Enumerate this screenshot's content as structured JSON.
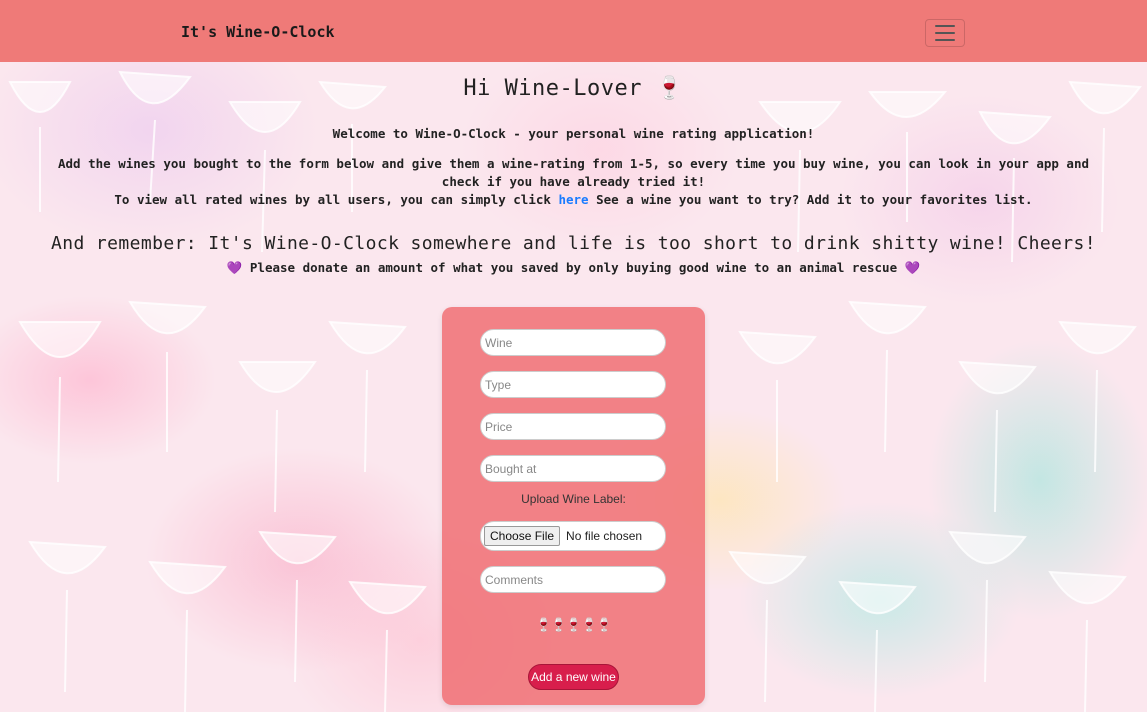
{
  "navbar": {
    "brand": "It's Wine-O-Clock",
    "toggle_icon": "hamburger-icon",
    "background": "#ef7a78"
  },
  "main": {
    "title": "Hi Wine-Lover 🍷",
    "welcome": "Welcome to Wine-O-Clock - your personal wine rating application!",
    "instructions": "Add the wines you bought to the form below and give them a wine-rating from 1-5, so every time you buy wine, you can look in your app and check if you have already tried it!",
    "view_prefix": "To view all rated wines by all users, you can simply click",
    "view_link": "here",
    "view_suffix": "See a wine you want to try? Add it to your favorites list.",
    "remember": "And remember: It's Wine-O-Clock somewhere and life is too short to drink shitty wine! Cheers!",
    "donate": "💜 Please donate an amount of what you saved by only buying good wine to an animal rescue 💜"
  },
  "form": {
    "wine_placeholder": "Wine",
    "type_placeholder": "Type",
    "price_placeholder": "Price",
    "bought_at_placeholder": "Bought at",
    "upload_label": "Upload Wine Label:",
    "file_button": "Choose File",
    "file_status": "No file chosen",
    "comments_placeholder": "Comments",
    "rating_glyphs": "🍷🍷🍷🍷🍷",
    "rating_max": 5,
    "submit_label": "Add a new wine",
    "card_color": "#ef6e73",
    "submit_color": "#d81e4c"
  }
}
